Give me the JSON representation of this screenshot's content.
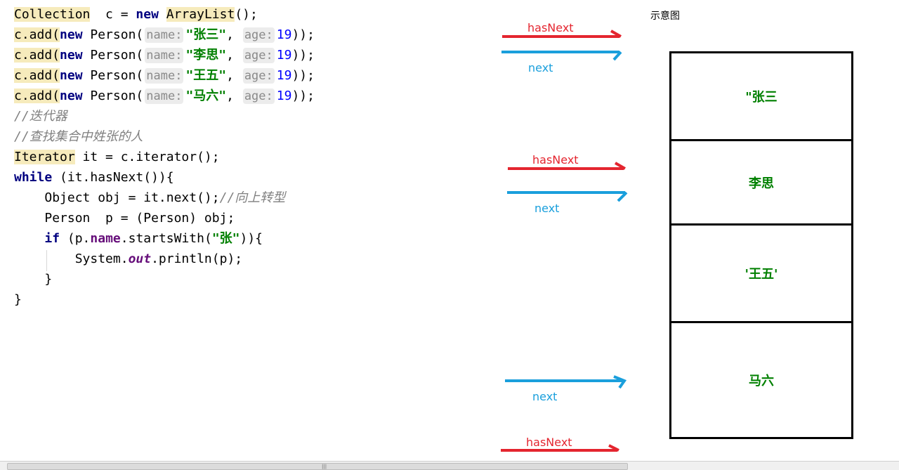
{
  "code": {
    "l1": {
      "type": "Collection",
      "mid": "  c = ",
      "new": "new",
      "cls": "ArrayList",
      "end": "();"
    },
    "adds": [
      {
        "pre": "c.add(",
        "new": "new",
        "person": " Person(",
        "hint_name": "name:",
        "value": "\"张三\"",
        "comma": ",",
        "hint_age": "age:",
        "age": "19",
        "end": "));"
      },
      {
        "pre": "c.add(",
        "new": "new",
        "person": " Person(",
        "hint_name": "name:",
        "value": "\"李思\"",
        "comma": ",",
        "hint_age": "age:",
        "age": "19",
        "end": "));"
      },
      {
        "pre": "c.add(",
        "new": "new",
        "person": " Person(",
        "hint_name": "name:",
        "value": "\"王五\"",
        "comma": ",",
        "hint_age": "age:",
        "age": "19",
        "end": "));"
      },
      {
        "pre": "c.add(",
        "new": "new",
        "person": " Person(",
        "hint_name": "name:",
        "value": "\"马六\"",
        "comma": ",",
        "hint_age": "age:",
        "age": "19",
        "end": "));"
      }
    ],
    "comment1": "//迭代器",
    "comment2": "//查找集合中姓张的人",
    "iter": {
      "type": "Iterator",
      "rest": " it = c.iterator();"
    },
    "while": {
      "kw": "while",
      "rest": " (it.hasNext()){"
    },
    "obj": {
      "indent": "    ",
      "code": "Object obj = it.next();",
      "comment": "//向上转型"
    },
    "person": {
      "indent": "    ",
      "code": "Person  p = (Person) obj;"
    },
    "if": {
      "indent": "    ",
      "kw": "if",
      "pre": " (p.",
      "field": "name",
      "mid": ".startsWith(",
      "str": "\"张\"",
      "end": ")){"
    },
    "print": {
      "indent": "        ",
      "pre": "System.",
      "field": "out",
      "end": ".println(p);"
    },
    "close_inner": "    }",
    "close_outer": "}"
  },
  "diagram": {
    "title": "示意图",
    "cells": [
      "\"张三",
      "李思",
      "'王五'",
      "马六"
    ],
    "labels": {
      "has_next_1": "hasNext",
      "next_1": "next",
      "has_next_2": "hasNext",
      "next_2": "next",
      "next_3": "next",
      "has_next_3": "hasNext"
    },
    "colors": {
      "has_next": "#e4252f",
      "next": "#1a9fdc",
      "cell_text": "#008000"
    }
  },
  "scrollbar": {
    "grip": "|||"
  }
}
